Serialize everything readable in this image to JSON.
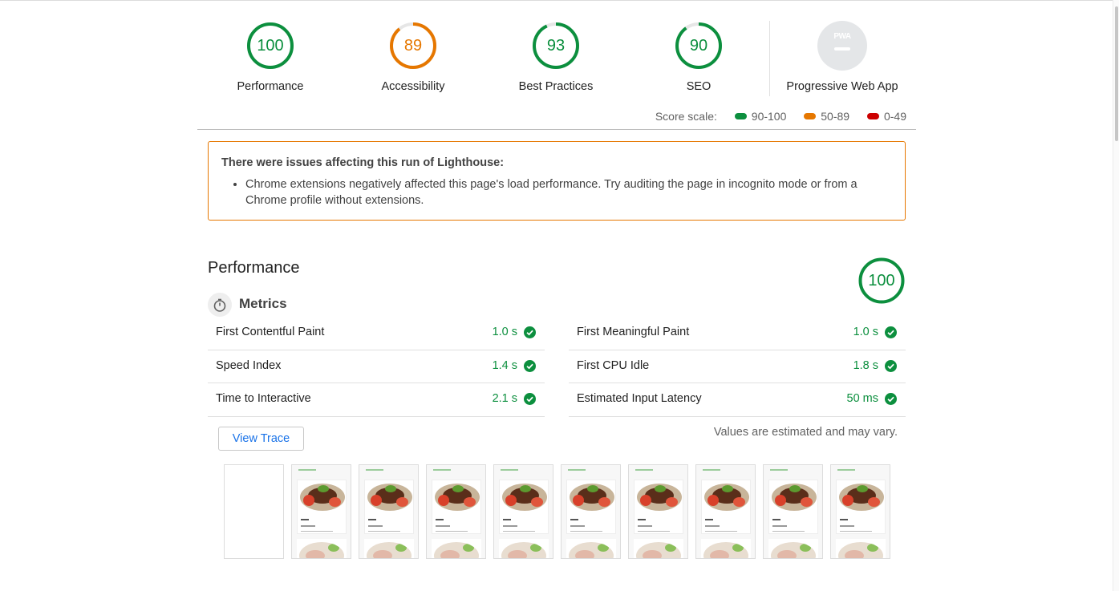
{
  "colors": {
    "pass": "#0c8f3e",
    "average": "#e67700",
    "fail": "#cc0000",
    "pwa_gray": "#e4e6e8",
    "link": "#1a73e8"
  },
  "gauges": [
    {
      "score": 100,
      "label": "Performance",
      "color": "#0c8f3e"
    },
    {
      "score": 89,
      "label": "Accessibility",
      "color": "#e67700"
    },
    {
      "score": 93,
      "label": "Best Practices",
      "color": "#0c8f3e"
    },
    {
      "score": 90,
      "label": "SEO",
      "color": "#0c8f3e"
    }
  ],
  "pwa": {
    "badge_text": "PWA",
    "label": "Progressive Web App"
  },
  "score_scale": {
    "label": "Score scale:",
    "ranges": [
      {
        "text": "90-100",
        "color": "#0c8f3e"
      },
      {
        "text": "50-89",
        "color": "#e67700"
      },
      {
        "text": "0-49",
        "color": "#cc0000"
      }
    ]
  },
  "warning": {
    "title": "There were issues affecting this run of Lighthouse:",
    "items": [
      "Chrome extensions negatively affected this page's load performance. Try auditing the page in incognito mode or from a Chrome profile without extensions."
    ]
  },
  "performance": {
    "title": "Performance",
    "score": 100,
    "metrics_label": "Metrics",
    "metrics_left": [
      {
        "name": "First Contentful Paint",
        "value": "1.0 s"
      },
      {
        "name": "Speed Index",
        "value": "1.4 s"
      },
      {
        "name": "Time to Interactive",
        "value": "2.1 s"
      }
    ],
    "metrics_right": [
      {
        "name": "First Meaningful Paint",
        "value": "1.0 s"
      },
      {
        "name": "First CPU Idle",
        "value": "1.8 s"
      },
      {
        "name": "Estimated Input Latency",
        "value": "50 ms"
      }
    ],
    "view_trace_label": "View Trace",
    "estimate_note": "Values are estimated and may vary.",
    "filmstrip": {
      "frame_count": 10,
      "blank_frames": 1
    }
  }
}
